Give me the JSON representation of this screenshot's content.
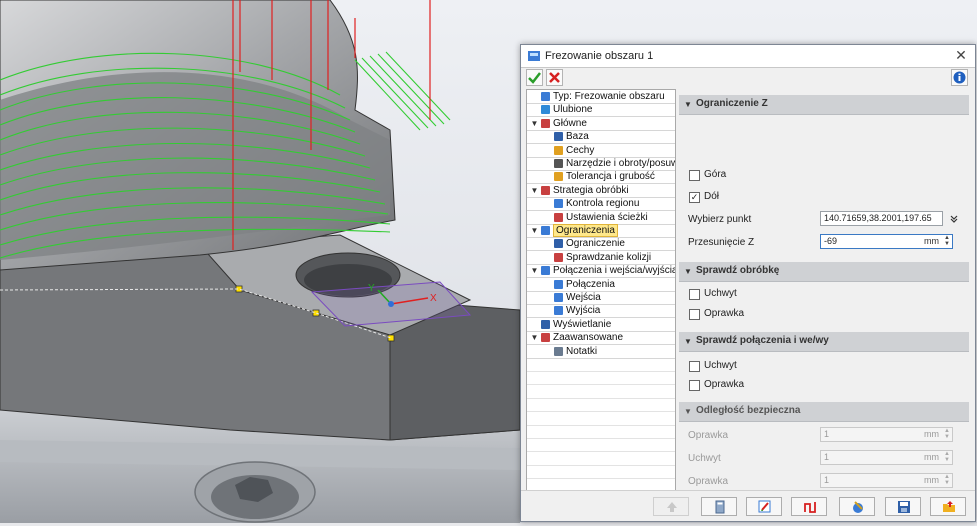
{
  "dialog": {
    "title": "Frezowanie obszaru 1",
    "close_glyph": "✕"
  },
  "tree": {
    "items": [
      {
        "label": "Typ: Frezowanie obszaru",
        "level": 0,
        "expander": "",
        "icon": "operation-icon"
      },
      {
        "label": "Ulubione",
        "level": 0,
        "expander": "",
        "icon": "star-icon"
      },
      {
        "label": "Główne",
        "level": 0,
        "expander": "▼",
        "icon": "main-icon"
      },
      {
        "label": "Baza",
        "level": 1,
        "expander": "",
        "icon": "axis-icon"
      },
      {
        "label": "Cechy",
        "level": 1,
        "expander": "",
        "icon": "feature-icon"
      },
      {
        "label": "Narzędzie i obroty/posuwy",
        "level": 1,
        "expander": "",
        "icon": "tool-icon"
      },
      {
        "label": "Tolerancja i grubość",
        "level": 1,
        "expander": "",
        "icon": "tolerance-icon"
      },
      {
        "label": "Strategia obróbki",
        "level": 0,
        "expander": "▼",
        "icon": "strategy-icon"
      },
      {
        "label": "Kontrola regionu",
        "level": 1,
        "expander": "",
        "icon": "region-icon"
      },
      {
        "label": "Ustawienia ścieżki",
        "level": 1,
        "expander": "",
        "icon": "path-icon"
      },
      {
        "label": "Ograniczenia",
        "level": 0,
        "expander": "▼",
        "icon": "limits-icon",
        "selected": true
      },
      {
        "label": "Ograniczenie",
        "level": 1,
        "expander": "",
        "icon": "limit-icon"
      },
      {
        "label": "Sprawdzanie kolizji",
        "level": 1,
        "expander": "",
        "icon": "collision-icon"
      },
      {
        "label": "Połączenia i wejścia/wyjścia",
        "level": 0,
        "expander": "▼",
        "icon": "links-icon"
      },
      {
        "label": "Połączenia",
        "level": 1,
        "expander": "",
        "icon": "link-icon"
      },
      {
        "label": "Wejścia",
        "level": 1,
        "expander": "",
        "icon": "lead-in-icon"
      },
      {
        "label": "Wyjścia",
        "level": 1,
        "expander": "",
        "icon": "lead-out-icon"
      },
      {
        "label": "Wyświetlanie",
        "level": 0,
        "expander": "",
        "icon": "display-icon"
      },
      {
        "label": "Zaawansowane",
        "level": 0,
        "expander": "▼",
        "icon": "advanced-icon"
      },
      {
        "label": "Notatki",
        "level": 1,
        "expander": "",
        "icon": "notes-icon"
      }
    ]
  },
  "sections": {
    "limit_z": {
      "title": "Ograniczenie Z",
      "top_label": "Góra",
      "top_checked": false,
      "bottom_label": "Dół",
      "bottom_checked": true,
      "pick_point_label": "Wybierz punkt",
      "pick_point_value": "140.71659,38.2001,197.65",
      "offset_label": "Przesunięcie Z",
      "offset_value": "-69",
      "unit": "mm"
    },
    "check_machining": {
      "title": "Sprawdź obróbkę",
      "holder_label": "Uchwyt",
      "holder_checked": false,
      "shank_label": "Oprawka",
      "shank_checked": false
    },
    "check_links": {
      "title": "Sprawdź połączenia i we/wy",
      "holder_label": "Uchwyt",
      "holder_checked": false,
      "shank_label": "Oprawka",
      "shank_checked": false
    },
    "safe_distance": {
      "title": "Odległość bezpieczna",
      "rows": [
        {
          "label": "Oprawka",
          "value": "1",
          "unit": "mm"
        },
        {
          "label": "Uchwyt",
          "value": "1",
          "unit": "mm"
        },
        {
          "label": "Oprawka",
          "value": "1",
          "unit": "mm"
        }
      ]
    }
  },
  "viewport": {
    "axis_x": "X",
    "axis_y": "Y"
  },
  "colors": {
    "ok_green": "#2a9d2a",
    "cancel_red": "#d62020",
    "info_blue": "#1f5fbf",
    "selected_bg": "#ffe88a",
    "toolpath_green": "#33cc33",
    "toolpath_red": "#e02020"
  }
}
